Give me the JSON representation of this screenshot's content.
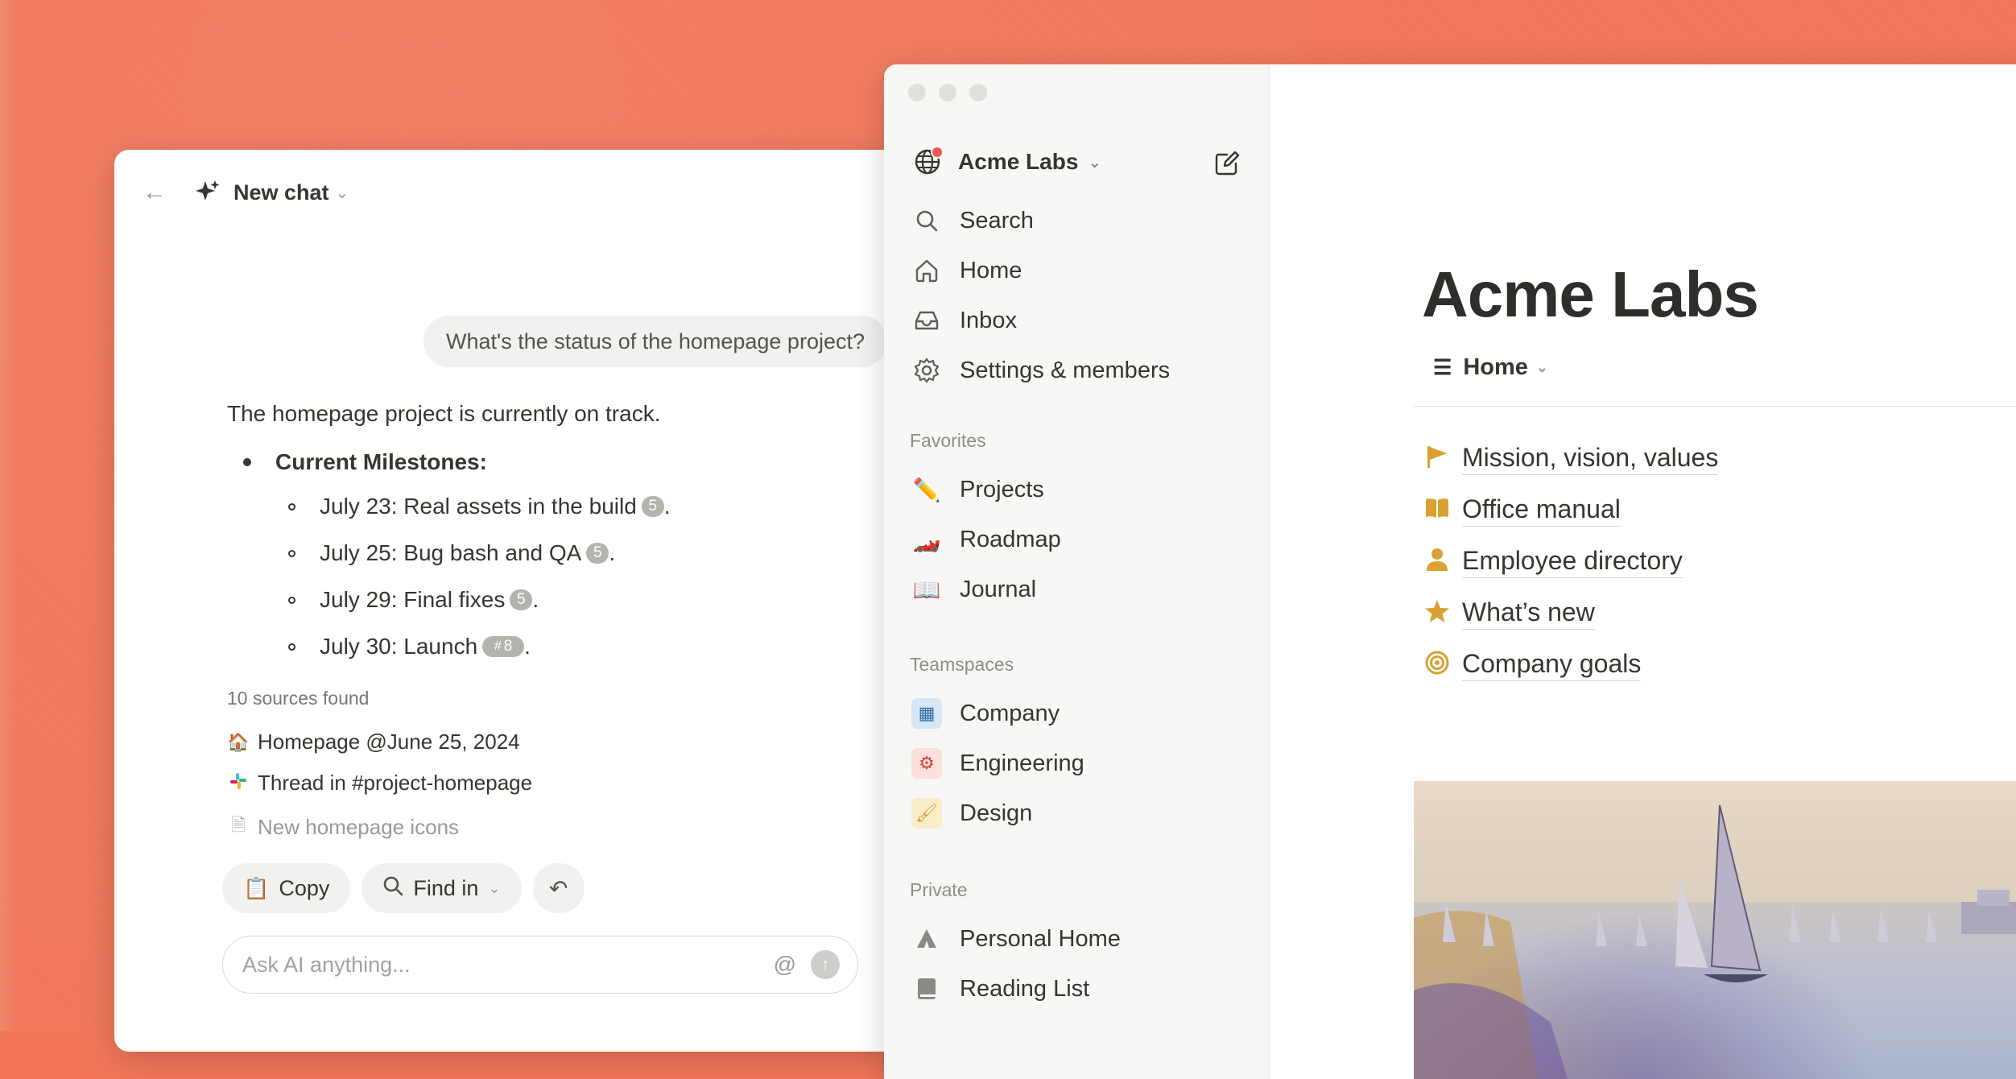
{
  "chat": {
    "title": "New chat",
    "user_message": "What's the status of the homepage project?",
    "answer_intro": "The homepage project is currently on track.",
    "milestones_heading": "Current Milestones:",
    "milestones": [
      {
        "text": "July 23: Real assets in the build",
        "cite": "5"
      },
      {
        "text": "July 25: Bug bash and QA",
        "cite": "5"
      },
      {
        "text": "July 29: Final fixes",
        "cite": "5"
      },
      {
        "text": "July 30: Launch",
        "cite": "8"
      }
    ],
    "sources_count": "10 sources found",
    "sources": [
      {
        "icon": "house-icon",
        "label": "Homepage @June 25, 2024"
      },
      {
        "icon": "slack-icon",
        "label": "Thread in #project-homepage"
      },
      {
        "icon": "document-icon",
        "label": "New homepage icons"
      }
    ],
    "actions": {
      "copy": "Copy",
      "find_in": "Find in"
    },
    "input_placeholder": "Ask AI anything..."
  },
  "sidebar": {
    "workspace": "Acme Labs",
    "nav": {
      "search": "Search",
      "home": "Home",
      "inbox": "Inbox",
      "settings": "Settings & members"
    },
    "favorites_label": "Favorites",
    "favorites": [
      "Projects",
      "Roadmap",
      "Journal"
    ],
    "teamspaces_label": "Teamspaces",
    "teamspaces": [
      "Company",
      "Engineering",
      "Design"
    ],
    "private_label": "Private",
    "private": [
      "Personal Home",
      "Reading List"
    ]
  },
  "page": {
    "title": "Acme Labs",
    "view_tab": "Home",
    "links": [
      {
        "icon": "flag-icon",
        "label": "Mission, vision, values"
      },
      {
        "icon": "book-icon",
        "label": "Office manual"
      },
      {
        "icon": "person-icon",
        "label": "Employee directory"
      },
      {
        "icon": "star-icon",
        "label": "What’s new"
      },
      {
        "icon": "target-icon",
        "label": "Company goals"
      }
    ]
  },
  "colors": {
    "background": "#f2775a",
    "accent_icon": "#d9a132",
    "notification_dot": "#eb5757"
  }
}
